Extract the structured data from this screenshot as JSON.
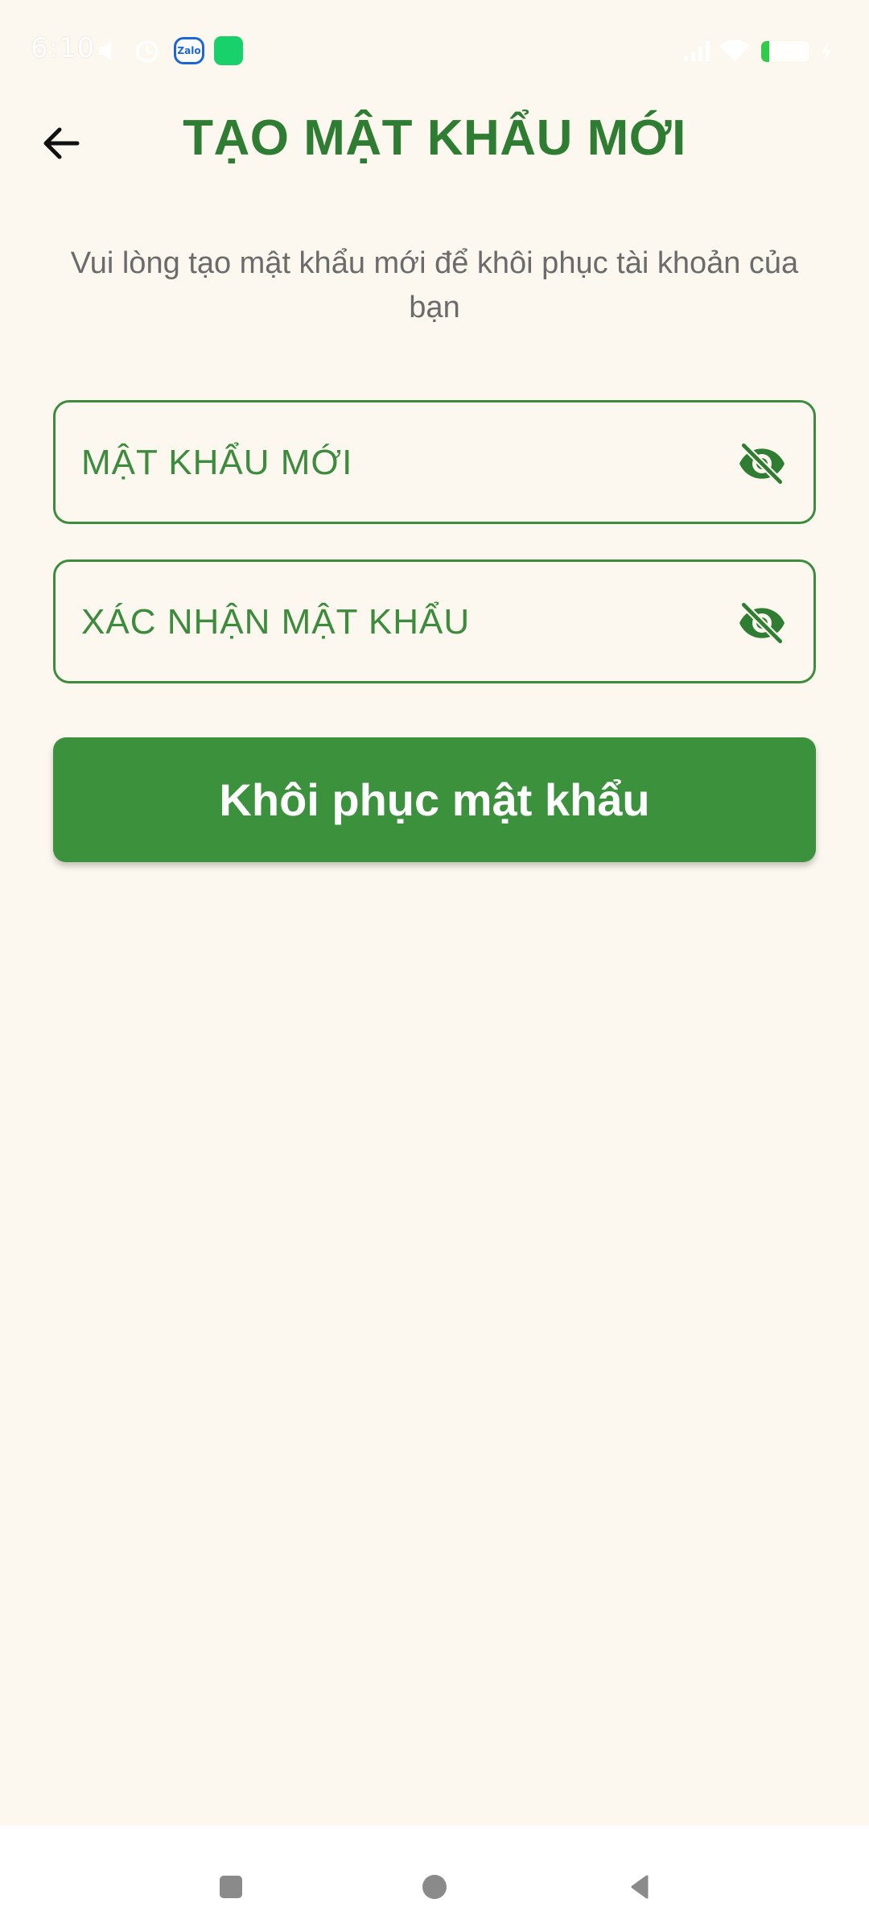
{
  "status_bar": {
    "time": "6:10",
    "icons": [
      "volume-icon",
      "alarm-icon",
      "zalo-app-icon",
      "app-notification-icon",
      "signal-icon",
      "wifi-icon",
      "battery-icon",
      "charging-icon"
    ],
    "zalo_label": "Zalo"
  },
  "header": {
    "back_icon": "arrow-left-icon",
    "title": "TẠO MẬT KHẨU MỚI"
  },
  "subtitle": "Vui lòng tạo mật khẩu mới để khôi phục tài khoản của bạn",
  "form": {
    "new_password": {
      "placeholder": "MẬT KHẨU MỚI",
      "value": "",
      "toggle_icon": "eye-off-icon"
    },
    "confirm_password": {
      "placeholder": "XÁC NHẬN MẬT KHẨU",
      "value": "",
      "toggle_icon": "eye-off-icon"
    },
    "submit_label": "Khôi phục mật khẩu"
  },
  "nav_bar": {
    "items": [
      "recent-apps-icon",
      "home-icon",
      "back-icon"
    ]
  },
  "colors": {
    "background": "#fcf8ef",
    "primary_green": "#2e7d32",
    "button_green": "#3c913c",
    "text_gray": "#6b6b6b"
  }
}
